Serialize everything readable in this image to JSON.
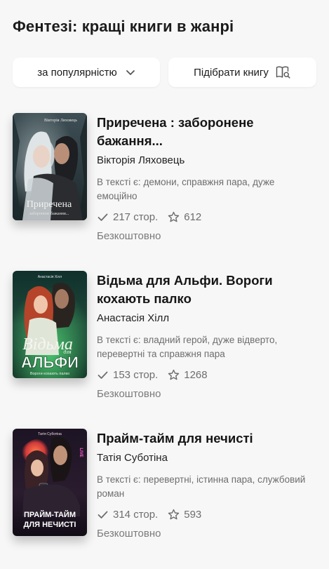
{
  "header": {
    "title": "Фентезі: кращі книги в жанрі"
  },
  "controls": {
    "sort_label": "за популярністю",
    "pick_label": "Підібрати книгу"
  },
  "tags_prefix": "В тексті є:",
  "books": [
    {
      "title": "Приречена : заборонене бажання...",
      "author": "Вікторія Ляховець",
      "tags": "демони, справжня пара, дуже емоційно",
      "pages": "217 стор.",
      "rating": "612",
      "price": "Безкоштовно",
      "cover": {
        "author": "Вікторія Ляховець",
        "title": "Приречена",
        "subtitle": "заборонене бажання..."
      }
    },
    {
      "title": "Відьма для Альфи. Вороги кохають палко",
      "author": "Анастасія Хілл",
      "tags": "владний герой, дуже відверто, перевертні та справжня пара",
      "pages": "153 стор.",
      "rating": "1268",
      "price": "Безкоштовно",
      "cover": {
        "author": "Анастасія Хілл",
        "title_top": "Відьма",
        "title_small": "для",
        "title_bottom": "АЛЬФИ",
        "subtitle": "Вороги кохають палко"
      }
    },
    {
      "title": "Прайм-тайм для нечисті",
      "author": "Татія Суботіна",
      "tags": "перевертні, істинна пара, службовий роман",
      "pages": "314 стор.",
      "rating": "593",
      "price": "Безкоштовно",
      "cover": {
        "author": "Татія Суботіна",
        "title_top": "ПРАЙМ-ТАЙМ",
        "title_bottom": "ДЛЯ НЕЧИСТІ",
        "sign": "LIVE"
      }
    }
  ],
  "colors": {
    "accent_bg": "#ffffff",
    "page_bg": "#f7f7f7",
    "muted": "#6d6d6d"
  }
}
